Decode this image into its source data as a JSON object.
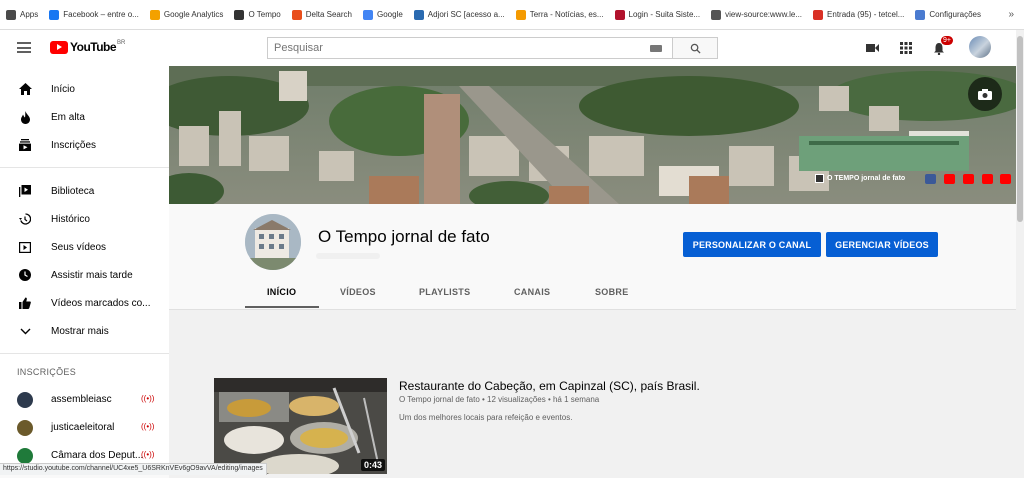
{
  "bookmarks": [
    {
      "label": "Apps",
      "color": "#4a4a4a"
    },
    {
      "label": "Facebook – entre o...",
      "color": "#1877f2"
    },
    {
      "label": "Google Analytics",
      "color": "#f4a100"
    },
    {
      "label": "O Tempo",
      "color": "#333333"
    },
    {
      "label": "Delta Search",
      "color": "#e94e1b"
    },
    {
      "label": "Google",
      "color": "#4285f4"
    },
    {
      "label": "Adjori SC [acesso a...",
      "color": "#2a6ab0"
    },
    {
      "label": "Terra - Notícias, es...",
      "color": "#f49a00"
    },
    {
      "label": "Login - Suita Siste...",
      "color": "#b1122c"
    },
    {
      "label": "view-source:www.le...",
      "color": "#555555"
    },
    {
      "label": "Entrada (95) - tetcel...",
      "color": "#d93025"
    },
    {
      "label": "Configurações",
      "color": "#4a7bd0"
    }
  ],
  "bookmarks_more": "»",
  "masthead": {
    "logo_text": "YouTube",
    "logo_country": "BR",
    "search_placeholder": "Pesquisar",
    "notification_count": "9+"
  },
  "sidebar": {
    "main": [
      {
        "label": "Início",
        "icon": "home-icon"
      },
      {
        "label": "Em alta",
        "icon": "fire-icon"
      },
      {
        "label": "Inscrições",
        "icon": "subscriptions-icon"
      }
    ],
    "library": [
      {
        "label": "Biblioteca",
        "icon": "library-icon"
      },
      {
        "label": "Histórico",
        "icon": "history-icon"
      },
      {
        "label": "Seus vídeos",
        "icon": "video-icon"
      },
      {
        "label": "Assistir mais tarde",
        "icon": "clock-icon"
      },
      {
        "label": "Vídeos marcados co...",
        "icon": "thumbs-up-icon"
      },
      {
        "label": "Mostrar mais",
        "icon": "chevron-down-icon"
      }
    ],
    "subscriptions_title": "INSCRIÇÕES",
    "subscriptions": [
      {
        "label": "assembleiasc",
        "color": "#2d3a4d",
        "live": "((•))"
      },
      {
        "label": "justicaeleitoral",
        "color": "#6b5a2b",
        "live": "((•))"
      },
      {
        "label": "Câmara dos Deput...",
        "color": "#1f7a3a",
        "live": "((•))"
      }
    ]
  },
  "banner": {
    "tag": "O TEMPO jornal de fato",
    "social_colors": [
      "#3b5998",
      "#ff0000",
      "#ff0000",
      "#ff0000",
      "#ff0000"
    ]
  },
  "channel": {
    "title": "O Tempo jornal de fato",
    "customize_label": "PERSONALIZAR O CANAL",
    "manage_label": "GERENCIAR VÍDEOS",
    "tabs": [
      "INÍCIO",
      "VÍDEOS",
      "PLAYLISTS",
      "CANAIS",
      "SOBRE"
    ]
  },
  "featured_video": {
    "title": "Restaurante do Cabeção, em Capinzal (SC), país Brasil.",
    "meta": "O Tempo jornal de fato • 12 visualizações • há 1 semana",
    "description": "Um dos melhores locais para refeição e eventos.",
    "duration": "0:43"
  },
  "status_url": "https://studio.youtube.com/channel/UC4xe5_U6SRKnVEv6gO9avVA/editing/images",
  "colors": {
    "accent": "#065fd4",
    "brand_red": "#ff0000"
  }
}
